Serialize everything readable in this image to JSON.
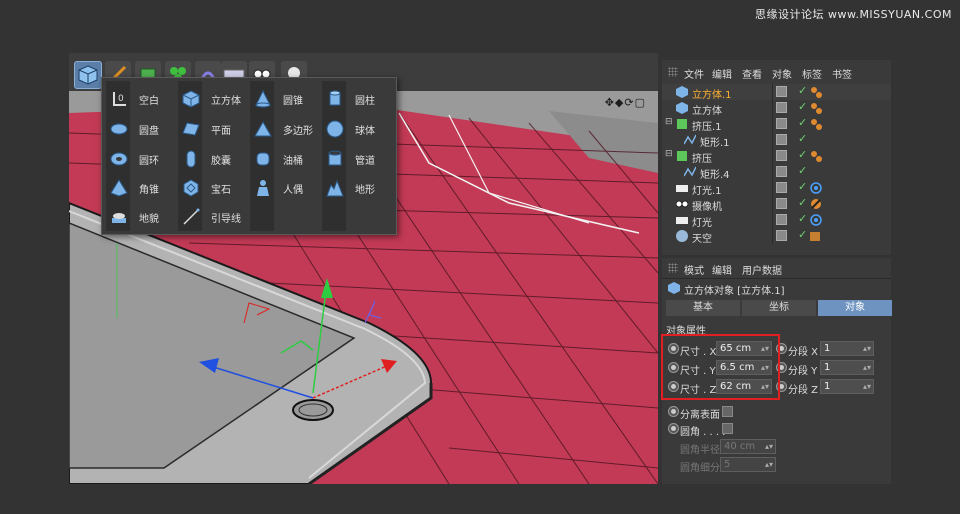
{
  "watermark": "思缘设计论坛 www.MISSYUAN.COM",
  "popup": {
    "items": [
      {
        "label": "空白",
        "icon": "null-icon"
      },
      {
        "label": "圆盘",
        "icon": "disc-icon"
      },
      {
        "label": "圆环",
        "icon": "torus-icon"
      },
      {
        "label": "角锥",
        "icon": "pyramid-icon"
      },
      {
        "label": "地貌",
        "icon": "landscape-icon"
      },
      {
        "label": "立方体",
        "icon": "cube-icon"
      },
      {
        "label": "平面",
        "icon": "plane-icon"
      },
      {
        "label": "胶囊",
        "icon": "capsule-icon"
      },
      {
        "label": "宝石",
        "icon": "gem-icon"
      },
      {
        "label": "引导线",
        "icon": "guide-icon"
      },
      {
        "label": "圆锥",
        "icon": "cone-icon"
      },
      {
        "label": "多边形",
        "icon": "polygon-icon"
      },
      {
        "label": "油桶",
        "icon": "oil-tank-icon"
      },
      {
        "label": "人偶",
        "icon": "figure-icon"
      },
      {
        "label": "圆柱",
        "icon": "cylinder-icon"
      },
      {
        "label": "球体",
        "icon": "sphere-icon"
      },
      {
        "label": "管道",
        "icon": "tube-icon"
      },
      {
        "label": "地形",
        "icon": "terrain-icon"
      }
    ]
  },
  "object_manager": {
    "menu": [
      "文件",
      "编辑",
      "查看",
      "对象",
      "标签",
      "书签"
    ],
    "rows": [
      {
        "name": "立方体.1",
        "selected": true,
        "icon": "cube-icon",
        "tag": "material-tag"
      },
      {
        "name": "立方体",
        "selected": false,
        "icon": "cube-icon",
        "tag": "material-tag"
      },
      {
        "name": "挤压.1",
        "selected": false,
        "icon": "extrude-icon",
        "tag": "material-tag"
      },
      {
        "name": "矩形.1",
        "selected": false,
        "icon": "spline-icon",
        "tag": ""
      },
      {
        "name": "挤压",
        "selected": false,
        "icon": "extrude-icon",
        "tag": "material-tag"
      },
      {
        "name": "矩形.4",
        "selected": false,
        "icon": "spline-icon",
        "tag": ""
      },
      {
        "name": "灯光.1",
        "selected": false,
        "icon": "light-icon",
        "tag": "target-tag"
      },
      {
        "name": "摄像机",
        "selected": false,
        "icon": "camera-icon",
        "tag": "protection-tag"
      },
      {
        "name": "灯光",
        "selected": false,
        "icon": "light-icon",
        "tag": "target-tag"
      },
      {
        "name": "天空",
        "selected": false,
        "icon": "sky-icon",
        "tag": "hdri-tag"
      }
    ]
  },
  "attribute_manager": {
    "menu": [
      "模式",
      "编辑",
      "用户数据"
    ],
    "title": "立方体对象 [立方体.1]",
    "tabs": [
      "基本",
      "坐标",
      "对象"
    ],
    "active_tab": "对象",
    "section": "对象属性",
    "size_x_label": "尺寸 . X",
    "size_x": "65 cm",
    "size_y_label": "尺寸 . Y",
    "size_y": "6.5 cm",
    "size_z_label": "尺寸 . Z",
    "size_z": "62 cm",
    "seg_x_label": "分段 X",
    "seg_x": "1",
    "seg_y_label": "分段 Y",
    "seg_y": "1",
    "seg_z_label": "分段 Z",
    "seg_z": "1",
    "separate_surfaces": "分离表面",
    "fillet": "圆角 . . . .",
    "fillet_radius_label": "圆角半径",
    "fillet_radius": "40 cm",
    "fillet_subdiv_label": "圆角细分",
    "fillet_subdiv": "5"
  },
  "colors": {
    "floor": "#c23a55",
    "selected_text": "#ffb232",
    "active_tab": "#6f93c0",
    "highlight_box": "#e02020"
  }
}
